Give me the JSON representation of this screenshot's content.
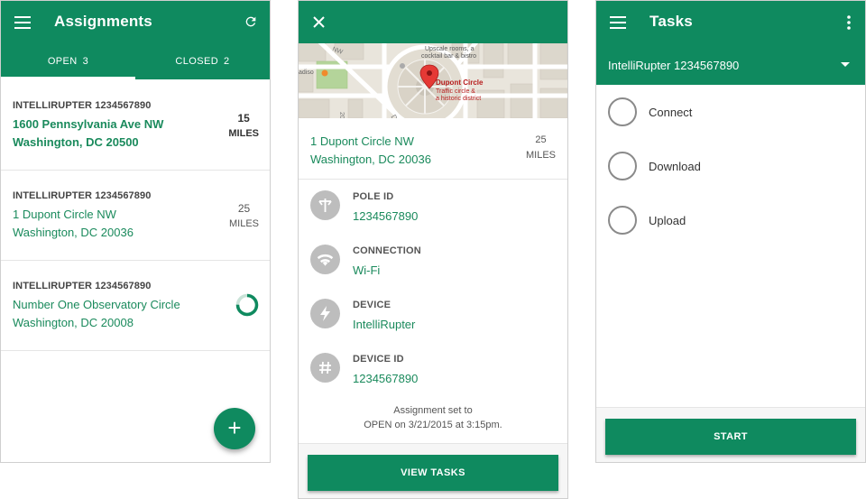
{
  "assignments_screen": {
    "title": "Assignments",
    "icons": {
      "menu": "menu-icon",
      "refresh": "refresh-icon",
      "add": "add-icon"
    },
    "tabs": [
      {
        "label": "OPEN",
        "count": "3",
        "active": true
      },
      {
        "label": "CLOSED",
        "count": "2",
        "active": false
      }
    ],
    "items": [
      {
        "device": "INTELLIRUPTER 1234567890",
        "address_line1": "1600 Pennsylvania Ave NW",
        "address_line2": "Washington, DC 20500",
        "distance": "15",
        "unit": "MILES",
        "unread": true
      },
      {
        "device": "INTELLIRUPTER 1234567890",
        "address_line1": "1 Dupont Circle NW",
        "address_line2": "Washington, DC 20036",
        "distance": "25",
        "unit": "MILES",
        "unread": false
      },
      {
        "device": "INTELLIRUPTER 1234567890",
        "address_line1": "Number One Observatory Circle",
        "address_line2": "Washington, DC 20008",
        "progress": 0.75,
        "unread": false
      }
    ],
    "fab_label": "+"
  },
  "detail_screen": {
    "icons": {
      "close": "close-icon"
    },
    "map": {
      "labels": [
        "Upscale rooms, a",
        "cocktail bar & bistro",
        "Dupont Circle",
        "Traffic circle &",
        "a historic district",
        "20th",
        "Du",
        "adiso",
        "NW"
      ]
    },
    "address_line1": "1 Dupont Circle NW",
    "address_line2": "Washington, DC 20036",
    "distance": "25",
    "unit": "MILES",
    "fields": [
      {
        "label": "POLE ID",
        "value": "1234567890",
        "icon": "pole-icon"
      },
      {
        "label": "CONNECTION",
        "value": "Wi-Fi",
        "icon": "wifi-icon"
      },
      {
        "label": "DEVICE",
        "value": "IntelliRupter",
        "icon": "lightning-icon"
      },
      {
        "label": "DEVICE ID",
        "value": "1234567890",
        "icon": "hash-icon"
      }
    ],
    "note_line1": "Assignment set to",
    "note_line2": "OPEN on 3/21/2015 at 3:15pm.",
    "button_label": "VIEW TASKS"
  },
  "tasks_screen": {
    "title": "Tasks",
    "icons": {
      "menu": "menu-icon",
      "overflow": "more-vert-icon",
      "dropdown": "chevron-down-icon"
    },
    "selected_device": "IntelliRupter 1234567890",
    "tasks": [
      {
        "label": "Connect",
        "checked": false
      },
      {
        "label": "Download",
        "checked": false
      },
      {
        "label": "Upload",
        "checked": false
      }
    ],
    "button_label": "START"
  },
  "colors": {
    "primary": "#0f8a5f",
    "link": "#1a8a5c",
    "divider": "#e5e5e5",
    "icon_circle": "#bdbdbd"
  }
}
